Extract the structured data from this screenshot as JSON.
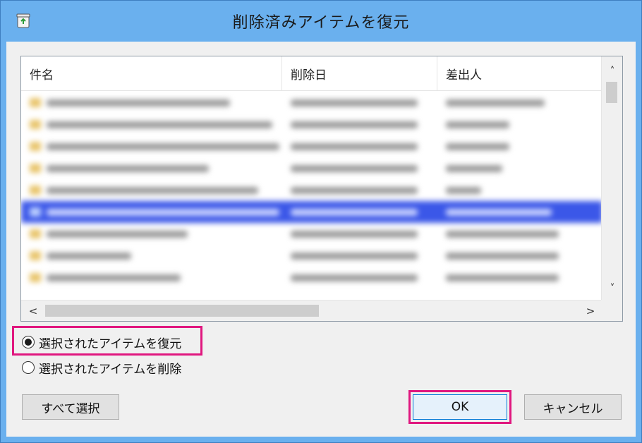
{
  "window": {
    "title": "削除済みアイテムを復元"
  },
  "list": {
    "columns": [
      "件名",
      "削除日",
      "差出人"
    ]
  },
  "options": {
    "restore_label": "選択されたアイテムを復元",
    "delete_label": "選択されたアイテムを削除",
    "selected": "restore"
  },
  "buttons": {
    "select_all": "すべて選択",
    "ok": "OK",
    "cancel": "キャンセル"
  },
  "colors": {
    "titlebar": "#6ab0ee",
    "highlight": "#e0177f",
    "selected_row": "#3b57e8"
  },
  "icons": {
    "app": "recycle-bin-icon",
    "scroll_up": "chevron-up-icon",
    "scroll_down": "chevron-down-icon",
    "scroll_left": "chevron-left-icon",
    "scroll_right": "chevron-right-icon"
  }
}
